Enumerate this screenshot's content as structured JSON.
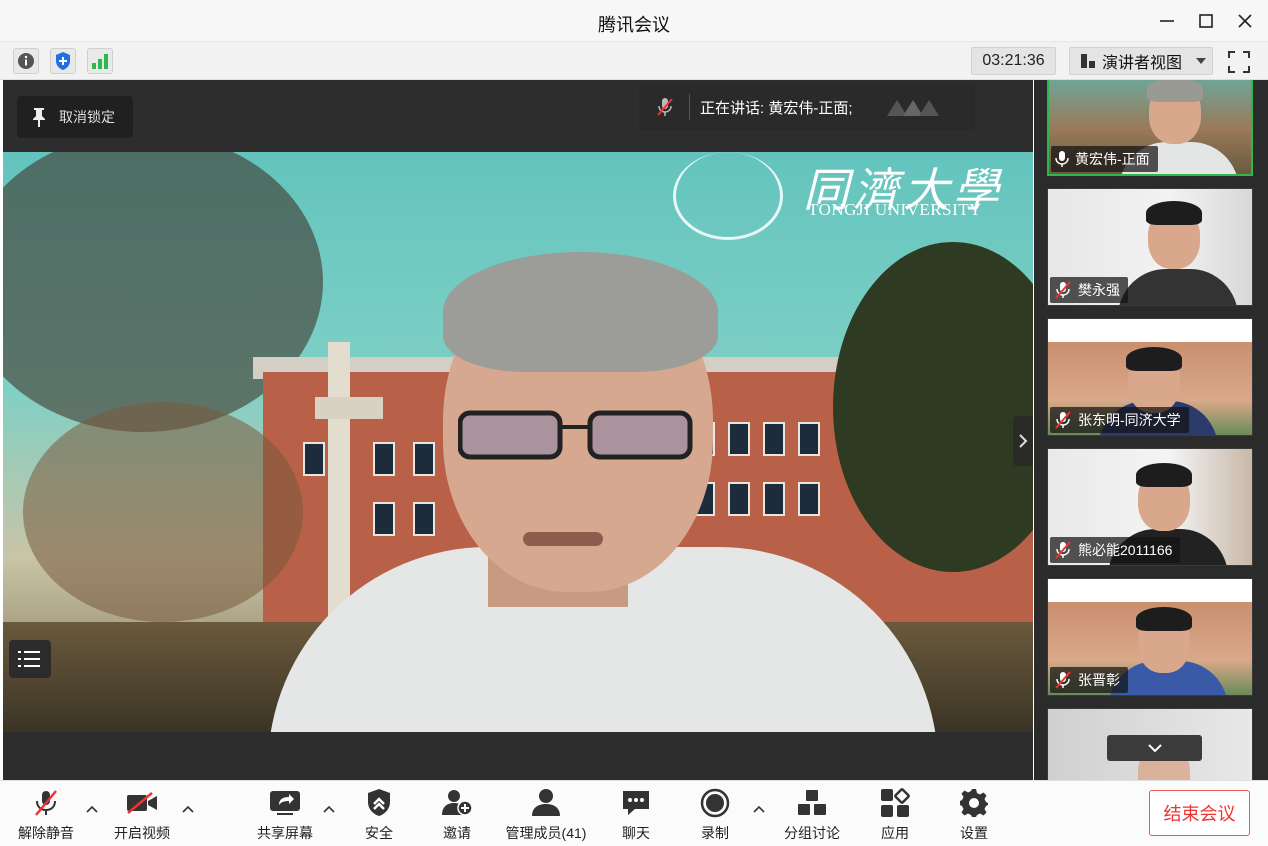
{
  "window": {
    "title": "腾讯会议",
    "minimize_icon": "minimize-icon",
    "maximize_icon": "maximize-icon",
    "close_icon": "close-icon"
  },
  "infobar": {
    "timer": "03:21:36",
    "view_mode": "演讲者视图"
  },
  "main": {
    "pin_label": "取消锁定",
    "speaking_label": "正在讲话: 黄宏伟-正面;",
    "logo_cn": "同濟大學",
    "logo_en": "TONGJI UNIVERSITY"
  },
  "participants": [
    {
      "name": "黄宏伟-正面",
      "muted": false
    },
    {
      "name": "樊永强",
      "muted": true
    },
    {
      "name": "张东明-同济大学",
      "muted": true
    },
    {
      "name": "熊必能2011166",
      "muted": true
    },
    {
      "name": "张晋彰",
      "muted": true
    }
  ],
  "toolbar": {
    "unmute": "解除静音",
    "start_video": "开启视频",
    "share_screen": "共享屏幕",
    "security": "安全",
    "invite": "邀请",
    "manage_members": "管理成员(41)",
    "chat": "聊天",
    "record": "录制",
    "breakout": "分组讨论",
    "apps": "应用",
    "settings": "设置",
    "end_meeting": "结束会议"
  },
  "colors": {
    "accent_green": "#2db84d",
    "end_red": "#e33333",
    "shield_blue": "#1f6fe5"
  }
}
